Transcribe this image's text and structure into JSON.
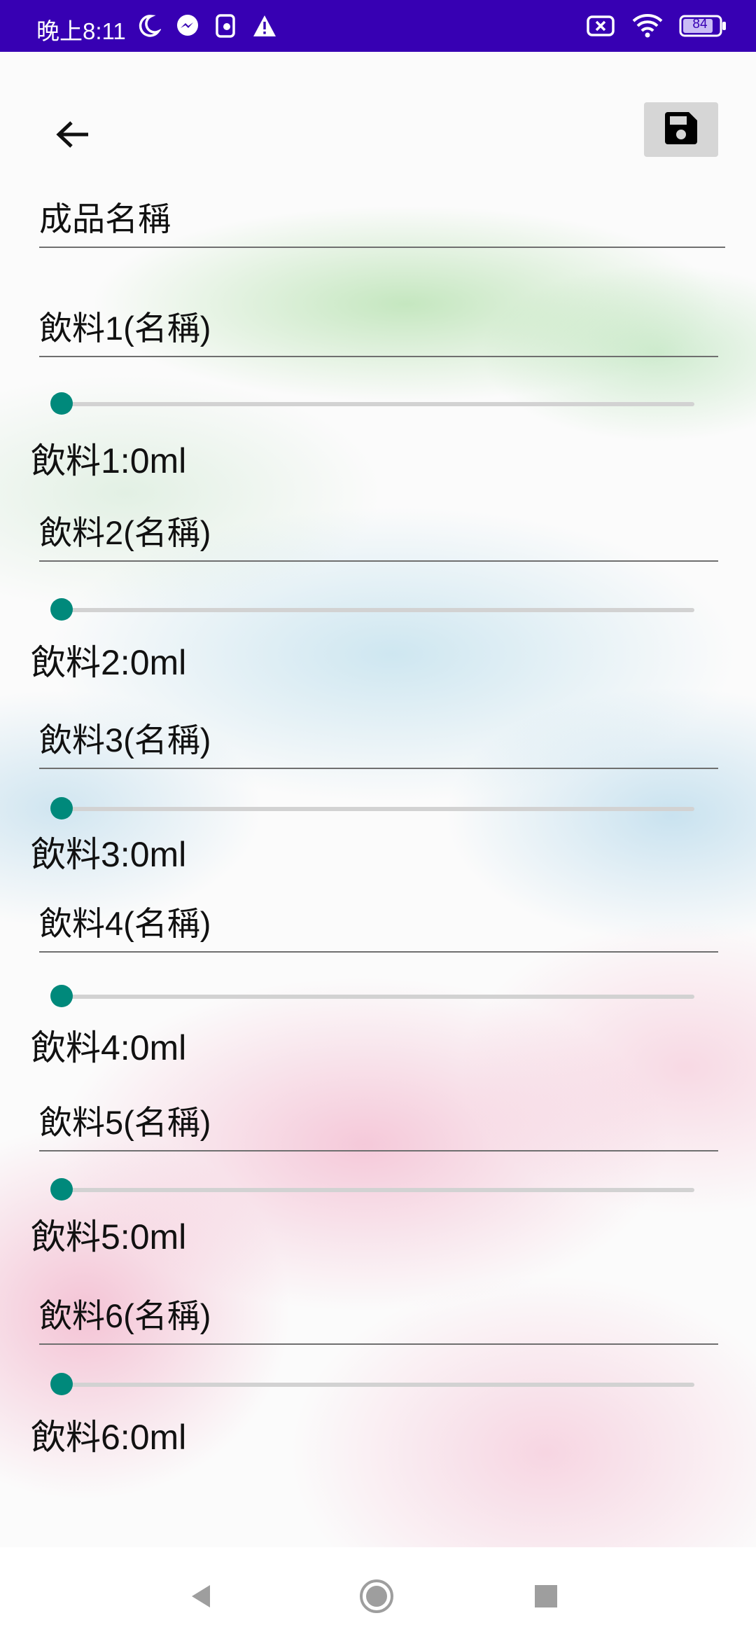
{
  "status_bar": {
    "time": "晚上8:11",
    "battery_level": "84",
    "icons_left": [
      "moon-icon",
      "messenger-icon",
      "notification-app-icon",
      "warning-icon"
    ],
    "icons_right": [
      "no-sim-icon",
      "wifi-icon",
      "battery-icon"
    ]
  },
  "toolbar": {
    "back_icon": "arrow-left-icon",
    "save_icon": "floppy-disk-icon"
  },
  "form": {
    "product_name_placeholder": "成品名稱",
    "drinks": [
      {
        "name_placeholder": "飲料1(名稱)",
        "amount_label": "飲料1:0ml",
        "slider_fraction": 0
      },
      {
        "name_placeholder": "飲料2(名稱)",
        "amount_label": "飲料2:0ml",
        "slider_fraction": 0
      },
      {
        "name_placeholder": "飲料3(名稱)",
        "amount_label": "飲料3:0ml",
        "slider_fraction": 0
      },
      {
        "name_placeholder": "飲料4(名稱)",
        "amount_label": "飲料4:0ml",
        "slider_fraction": 0
      },
      {
        "name_placeholder": "飲料5(名稱)",
        "amount_label": "飲料5:0ml",
        "slider_fraction": 0
      },
      {
        "name_placeholder": "飲料6(名稱)",
        "amount_label": "飲料6:0ml",
        "slider_fraction": 0
      }
    ]
  },
  "nav_bar": {
    "back": "triangle-back-icon",
    "home": "circle-home-icon",
    "recents": "square-recents-icon"
  },
  "colors": {
    "status_bar": "#3700b3",
    "slider_thumb": "#00897b",
    "slider_track": "#d2d2d2",
    "save_button_bg": "#d6d6d6"
  }
}
